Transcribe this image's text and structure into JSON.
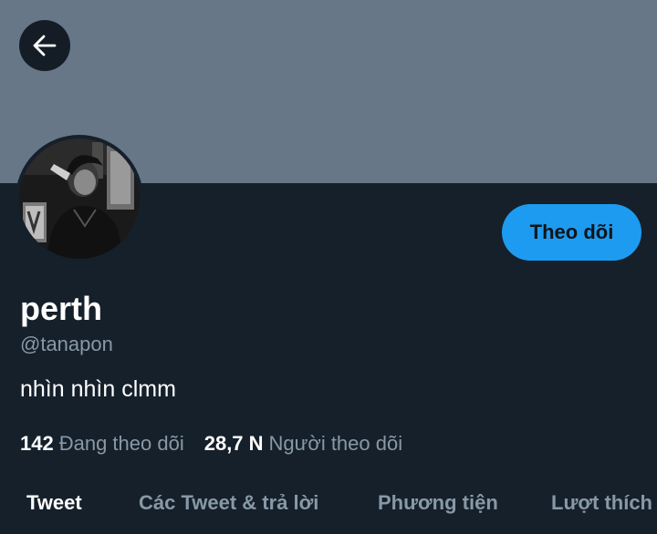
{
  "header": {
    "back_icon": "arrow-left-icon",
    "banner_color": "#677788"
  },
  "profile": {
    "display_name": "perth",
    "handle": "@tanapon",
    "bio": "nhìn nhìn clmm",
    "follow_label": "Theo dõi",
    "accent_color": "#1d9bf0"
  },
  "stats": {
    "following_count": "142",
    "following_label": "Đang theo dõi",
    "followers_count": "28,7 N",
    "followers_label": "Người theo dõi"
  },
  "tabs": [
    {
      "label": "Tweet",
      "active": true
    },
    {
      "label": "Các Tweet & trả lời",
      "active": false
    },
    {
      "label": "Phương tiện",
      "active": false
    },
    {
      "label": "Lượt thích",
      "active": false
    }
  ]
}
